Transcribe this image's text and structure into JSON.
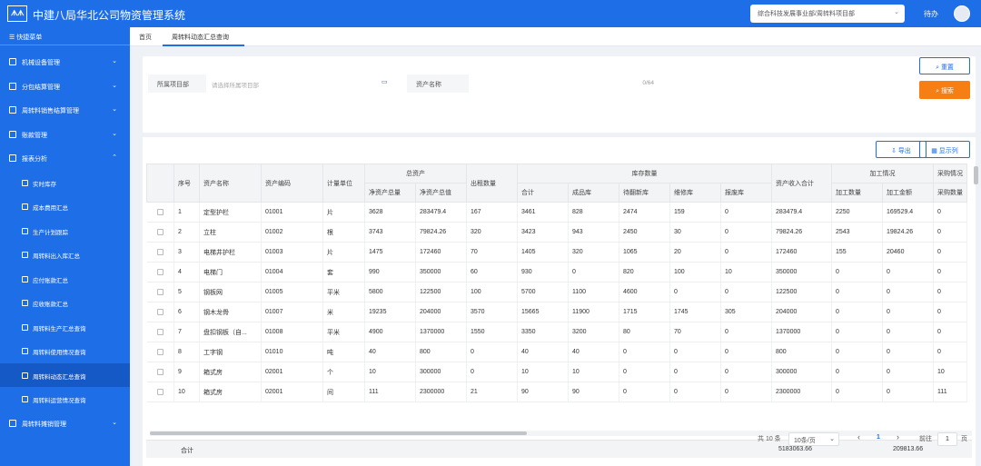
{
  "header": {
    "logo_text": "ᗑᗑ",
    "app_title": "中建八局华北公司物资管理系统",
    "org_select": "综合科技发展事业部/周转料项目部",
    "user_name": "待办"
  },
  "sidebar": {
    "quick_menu": "快捷菜单",
    "items": [
      {
        "label": "机械设备管理"
      },
      {
        "label": "分包结算管理"
      },
      {
        "label": "周转料销售结算管理"
      },
      {
        "label": "账款管理"
      },
      {
        "label": "报表分析"
      }
    ],
    "sub_items": [
      {
        "label": "实时库存"
      },
      {
        "label": "成本费用汇总"
      },
      {
        "label": "生产计划跟踪"
      },
      {
        "label": "周转料出入库汇总"
      },
      {
        "label": "应付账款汇总"
      },
      {
        "label": "应收账款汇总"
      },
      {
        "label": "周转料生产汇总查询"
      },
      {
        "label": "周转料使用情况查询"
      },
      {
        "label": "周转料动态汇总查询"
      },
      {
        "label": "周转料运营情况查询"
      }
    ],
    "bottom_item": "周转料摊销管理"
  },
  "tabs": {
    "home": "首页",
    "current": "周转料动态汇总查询"
  },
  "filter": {
    "project_label": "所属项目部",
    "project_placeholder": "请选择所属项目部",
    "asset_label": "资产名称",
    "asset_counter": "0/64",
    "reset_label": "重置",
    "search_label": "搜索"
  },
  "toolbar": {
    "export_label": "导出",
    "columns_label": "显示列"
  },
  "table": {
    "group_headers": {
      "total_assets": "总资产",
      "stock": "库存数量",
      "processing": "加工情况",
      "purchase": "采购情况"
    },
    "headers": {
      "index": "序号",
      "asset_name": "资产名称",
      "asset_code": "资产编码",
      "unit": "计量单位",
      "net_total_qty": "净资产总量",
      "net_total_value": "净资产总值",
      "rent_qty": "出租数量",
      "stock_total": "合计",
      "finished": "成品库",
      "pending_repair": "待翻新库",
      "repair": "维修库",
      "scrap": "报废库",
      "income_total": "资产收入合计",
      "process_qty": "加工数量",
      "process_amount": "加工金额",
      "purchase_qty": "采购数量"
    },
    "rows": [
      {
        "idx": "1",
        "name": "定型护栏",
        "code": "01001",
        "unit": "片",
        "nq": "3628",
        "nv": "283479.4",
        "rent": "167",
        "st": "3461",
        "fin": "828",
        "pend": "2474",
        "rep": "159",
        "scr": "0",
        "inc": "283479.4",
        "pq": "2250",
        "pa": "169529.4",
        "buy": "0"
      },
      {
        "idx": "2",
        "name": "立柱",
        "code": "01002",
        "unit": "根",
        "nq": "3743",
        "nv": "79824.26",
        "rent": "320",
        "st": "3423",
        "fin": "943",
        "pend": "2450",
        "rep": "30",
        "scr": "0",
        "inc": "79824.26",
        "pq": "2543",
        "pa": "19824.26",
        "buy": "0"
      },
      {
        "idx": "3",
        "name": "电梯井护栏",
        "code": "01003",
        "unit": "片",
        "nq": "1475",
        "nv": "172460",
        "rent": "70",
        "st": "1405",
        "fin": "320",
        "pend": "1065",
        "rep": "20",
        "scr": "0",
        "inc": "172460",
        "pq": "155",
        "pa": "20460",
        "buy": "0"
      },
      {
        "idx": "4",
        "name": "电梯门",
        "code": "01004",
        "unit": "套",
        "nq": "990",
        "nv": "350000",
        "rent": "60",
        "st": "930",
        "fin": "0",
        "pend": "820",
        "rep": "100",
        "scr": "10",
        "inc": "350000",
        "pq": "0",
        "pa": "0",
        "buy": "0"
      },
      {
        "idx": "5",
        "name": "钢板网",
        "code": "01005",
        "unit": "平米",
        "nq": "5800",
        "nv": "122500",
        "rent": "100",
        "st": "5700",
        "fin": "1100",
        "pend": "4600",
        "rep": "0",
        "scr": "0",
        "inc": "122500",
        "pq": "0",
        "pa": "0",
        "buy": "0"
      },
      {
        "idx": "6",
        "name": "钢木龙骨",
        "code": "01007",
        "unit": "米",
        "nq": "19235",
        "nv": "204000",
        "rent": "3570",
        "st": "15665",
        "fin": "11900",
        "pend": "1715",
        "rep": "1745",
        "scr": "305",
        "inc": "204000",
        "pq": "0",
        "pa": "0",
        "buy": "0"
      },
      {
        "idx": "7",
        "name": "盘扣钢板（自...",
        "code": "01008",
        "unit": "平米",
        "nq": "4900",
        "nv": "1370000",
        "rent": "1550",
        "st": "3350",
        "fin": "3200",
        "pend": "80",
        "rep": "70",
        "scr": "0",
        "inc": "1370000",
        "pq": "0",
        "pa": "0",
        "buy": "0"
      },
      {
        "idx": "8",
        "name": "工字钢",
        "code": "01010",
        "unit": "吨",
        "nq": "40",
        "nv": "800",
        "rent": "0",
        "st": "40",
        "fin": "40",
        "pend": "0",
        "rep": "0",
        "scr": "0",
        "inc": "800",
        "pq": "0",
        "pa": "0",
        "buy": "0"
      },
      {
        "idx": "9",
        "name": "箱式房",
        "code": "02001",
        "unit": "个",
        "nq": "10",
        "nv": "300000",
        "rent": "0",
        "st": "10",
        "fin": "10",
        "pend": "0",
        "rep": "0",
        "scr": "0",
        "inc": "300000",
        "pq": "0",
        "pa": "0",
        "buy": "10"
      },
      {
        "idx": "10",
        "name": "箱式房",
        "code": "02001",
        "unit": "间",
        "nq": "111",
        "nv": "2300000",
        "rent": "21",
        "st": "90",
        "fin": "90",
        "pend": "0",
        "rep": "0",
        "scr": "0",
        "inc": "2300000",
        "pq": "0",
        "pa": "0",
        "buy": "111"
      }
    ],
    "summary": {
      "label": "合计",
      "income_total": "5183063.66",
      "process_amount": "209813.66"
    }
  },
  "pagination": {
    "total": "共 10 条",
    "page_size": "10条/页",
    "prev": "‹",
    "current_page": "1",
    "next": "›",
    "goto_label": "前往",
    "goto_value": "1",
    "page_suffix": "页"
  }
}
